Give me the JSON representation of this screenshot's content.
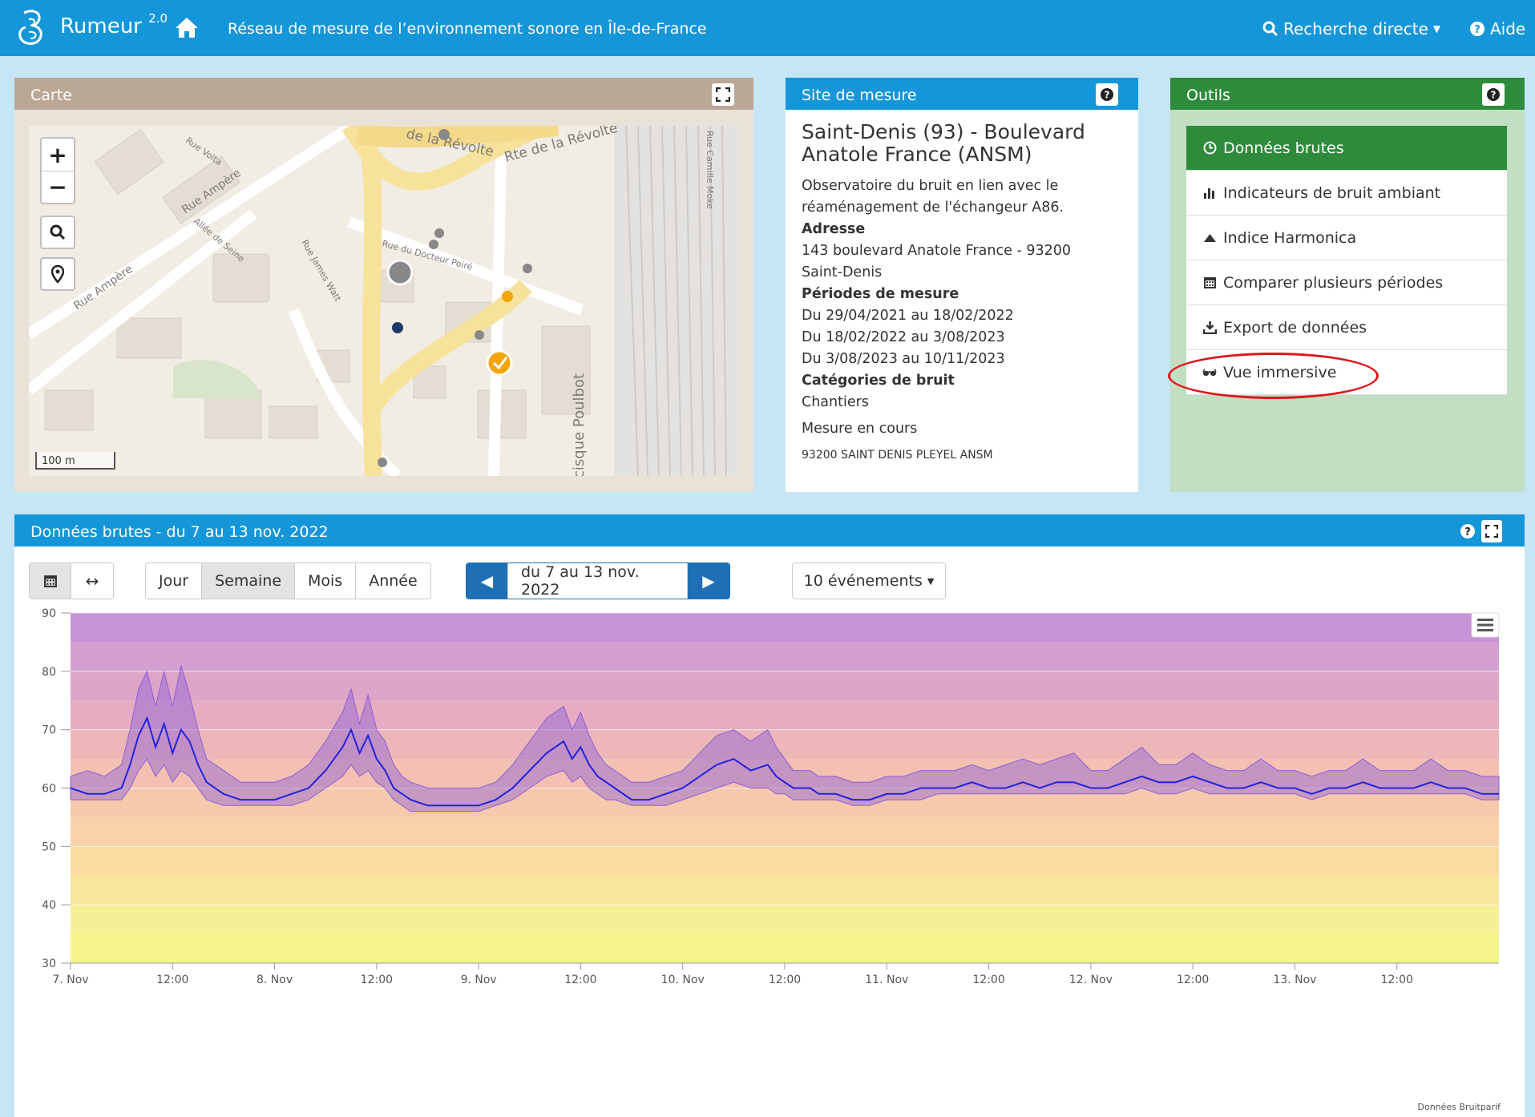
{
  "header": {
    "brand": "Rumeur",
    "version": "2.0",
    "tagline": "Réseau de mesure de l’environnement sonore en Île-de-France",
    "search_label": "Recherche directe",
    "help_label": "Aide"
  },
  "map_panel": {
    "title": "Carte",
    "scale_label": "100 m",
    "street_labels": [
      "Rue Ampère",
      "Rue Ampère",
      "Rue Volta",
      "Allée de Seine",
      "Rue James Watt",
      "Rue du Docteur Poiré",
      "Rte de la Révolte",
      "de la Révolte",
      "Rue Camille Moke",
      "cisque Poulbot"
    ]
  },
  "site_panel": {
    "title": "Site de mesure",
    "site_name": "Saint-Denis (93) - Boulevard Anatole France (ANSM)",
    "description": "Observatoire du bruit en lien avec le réaménagement de l'échangeur A86.",
    "address_label": "Adresse",
    "address_line1": "143 boulevard Anatole France - 93200",
    "address_line2": "Saint-Denis",
    "periods_label": "Périodes de mesure",
    "periods": [
      "Du 29/04/2021 au 18/02/2022",
      "Du 18/02/2022 au 3/08/2023",
      "Du 3/08/2023 au 10/11/2023"
    ],
    "categories_label": "Catégories de bruit",
    "category": "Chantiers",
    "status": "Mesure en cours",
    "footer_cut": "93200 SAINT DENIS PLEYEL ANSM"
  },
  "tools_panel": {
    "title": "Outils",
    "items": [
      {
        "label": "Données brutes",
        "icon": "clock-icon"
      },
      {
        "label": "Indicateurs de bruit ambiant",
        "icon": "bar-chart-icon"
      },
      {
        "label": "Indice Harmonica",
        "icon": "triangle-up-icon"
      },
      {
        "label": "Comparer plusieurs périodes",
        "icon": "calendar-icon"
      },
      {
        "label": "Export de données",
        "icon": "download-icon"
      },
      {
        "label": "Vue immersive",
        "icon": "glasses-icon"
      }
    ]
  },
  "data_panel": {
    "title": "Données brutes - du 7 au 13 nov. 2022",
    "period_buttons": [
      "Jour",
      "Semaine",
      "Mois",
      "Année"
    ],
    "selected_period": "Semaine",
    "date_range": "du 7 au 13 nov. 2022",
    "events_label": "10 événements",
    "credit": "Données Bruitparif"
  },
  "colors": {
    "header": "#1596d8",
    "tools_active": "#2e8b3b",
    "series_line": "#2222dd",
    "series_band": "#8b5fd6",
    "highlight": "#e0161b"
  },
  "chart_data": {
    "type": "line",
    "x_ticks": [
      "7. Nov",
      "12:00",
      "8. Nov",
      "12:00",
      "9. Nov",
      "12:00",
      "10. Nov",
      "12:00",
      "11. Nov",
      "12:00",
      "12. Nov",
      "12:00",
      "13. Nov",
      "12:00"
    ],
    "y_ticks": [
      30,
      40,
      50,
      60,
      70,
      80,
      90
    ],
    "ylim": [
      30,
      90
    ],
    "xlim_days": [
      0,
      7
    ],
    "background_bands": [
      {
        "from": 30,
        "to": 35,
        "color": "#f6f58d"
      },
      {
        "from": 35,
        "to": 40,
        "color": "#f7ee98"
      },
      {
        "from": 40,
        "to": 45,
        "color": "#f8e69e"
      },
      {
        "from": 45,
        "to": 50,
        "color": "#f8dca2"
      },
      {
        "from": 50,
        "to": 55,
        "color": "#f8d2a8"
      },
      {
        "from": 55,
        "to": 60,
        "color": "#f6c9ad"
      },
      {
        "from": 60,
        "to": 65,
        "color": "#f3c0b2"
      },
      {
        "from": 65,
        "to": 70,
        "color": "#edb6b9"
      },
      {
        "from": 70,
        "to": 75,
        "color": "#e6acc1"
      },
      {
        "from": 75,
        "to": 80,
        "color": "#dea5c9"
      },
      {
        "from": 80,
        "to": 85,
        "color": "#d49fd1"
      },
      {
        "from": 85,
        "to": 90,
        "color": "#c793d8"
      }
    ],
    "series": [
      {
        "x_hours": [
          0,
          2,
          4,
          6,
          7,
          8,
          9,
          10,
          11,
          12,
          13,
          14,
          15,
          16,
          18,
          20,
          22,
          24,
          26,
          28,
          30,
          32,
          33,
          34,
          35,
          36,
          37,
          38,
          39,
          40,
          42,
          44,
          46,
          48,
          50,
          52,
          54,
          56,
          58,
          59,
          60,
          61,
          62,
          63,
          64,
          66,
          68,
          70,
          72,
          74,
          76,
          78,
          80,
          82,
          83,
          84,
          85,
          86,
          87,
          88,
          90,
          92,
          94,
          96,
          98,
          100,
          102,
          104,
          106,
          108,
          110,
          112,
          114,
          116,
          118,
          120,
          122,
          124,
          126,
          128,
          130,
          132,
          134,
          136,
          138,
          140,
          142,
          144,
          146,
          148,
          150,
          152,
          154,
          156,
          158,
          160,
          162,
          164,
          166,
          168
        ],
        "values": [
          60,
          59,
          59,
          60,
          64,
          69,
          72,
          67,
          71,
          66,
          70,
          68,
          64,
          61,
          59,
          58,
          58,
          58,
          59,
          60,
          63,
          67,
          70,
          66,
          69,
          65,
          63,
          60,
          59,
          58,
          57,
          57,
          57,
          57,
          58,
          60,
          63,
          66,
          68,
          65,
          67,
          64,
          62,
          61,
          60,
          58,
          58,
          59,
          60,
          62,
          64,
          65,
          63,
          64,
          62,
          61,
          60,
          60,
          60,
          59,
          59,
          58,
          58,
          59,
          59,
          60,
          60,
          60,
          61,
          60,
          60,
          61,
          60,
          61,
          61,
          60,
          60,
          61,
          62,
          61,
          61,
          62,
          61,
          60,
          60,
          61,
          60,
          60,
          59,
          60,
          60,
          61,
          60,
          60,
          60,
          61,
          60,
          60,
          59,
          59
        ],
        "min": [
          58,
          58,
          58,
          58,
          60,
          63,
          65,
          62,
          64,
          61,
          63,
          62,
          60,
          58,
          57,
          57,
          57,
          57,
          57,
          58,
          60,
          62,
          64,
          62,
          63,
          61,
          60,
          58,
          57,
          56,
          56,
          56,
          56,
          56,
          57,
          58,
          60,
          62,
          63,
          61,
          62,
          60,
          59,
          58,
          58,
          57,
          57,
          57,
          58,
          59,
          60,
          61,
          60,
          60,
          59,
          59,
          58,
          58,
          58,
          58,
          58,
          57,
          57,
          58,
          58,
          58,
          59,
          59,
          59,
          59,
          59,
          59,
          59,
          59,
          59,
          59,
          59,
          59,
          60,
          59,
          59,
          60,
          59,
          59,
          59,
          59,
          59,
          59,
          58,
          59,
          59,
          59,
          59,
          59,
          59,
          59,
          59,
          59,
          58,
          58
        ],
        "max": [
          62,
          63,
          62,
          64,
          70,
          77,
          80,
          74,
          80,
          74,
          81,
          76,
          70,
          65,
          63,
          61,
          61,
          61,
          62,
          64,
          68,
          73,
          77,
          71,
          76,
          70,
          68,
          64,
          62,
          61,
          60,
          60,
          60,
          60,
          61,
          64,
          68,
          72,
          74,
          70,
          73,
          69,
          66,
          64,
          63,
          61,
          61,
          62,
          63,
          66,
          69,
          70,
          68,
          70,
          67,
          65,
          63,
          63,
          63,
          62,
          62,
          61,
          61,
          62,
          62,
          63,
          63,
          63,
          64,
          63,
          64,
          65,
          64,
          65,
          66,
          63,
          63,
          65,
          67,
          64,
          64,
          66,
          64,
          63,
          63,
          65,
          63,
          63,
          62,
          63,
          63,
          65,
          63,
          63,
          63,
          65,
          63,
          63,
          62,
          62
        ]
      }
    ]
  }
}
